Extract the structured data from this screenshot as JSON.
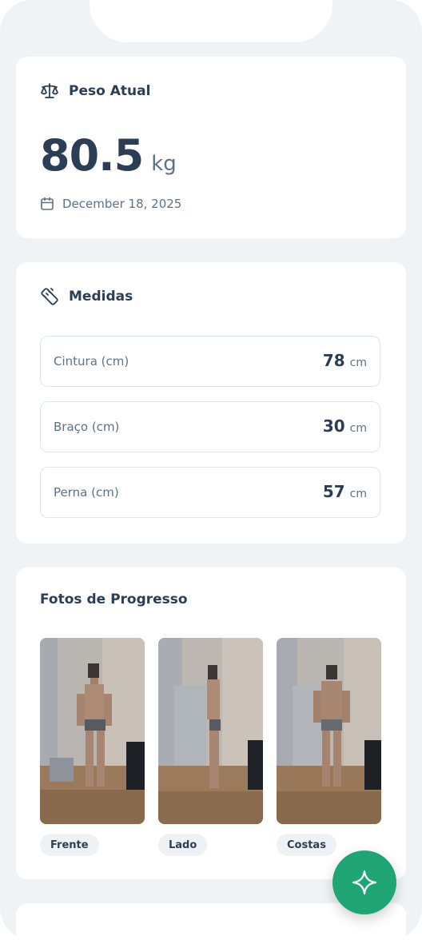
{
  "weight_card": {
    "title": "Peso Atual",
    "value": "80.5",
    "unit": "kg",
    "date": "December 18, 2025",
    "icons": {
      "title": "scale-icon",
      "date": "calendar-icon"
    }
  },
  "measures_card": {
    "title": "Medidas",
    "icon": "ruler-icon",
    "items": [
      {
        "label": "Cintura (cm)",
        "value": "78",
        "unit": "cm"
      },
      {
        "label": "Braço (cm)",
        "value": "30",
        "unit": "cm"
      },
      {
        "label": "Perna (cm)",
        "value": "57",
        "unit": "cm"
      }
    ]
  },
  "photos_card": {
    "title": "Fotos de Progresso",
    "photos": [
      {
        "label": "Frente"
      },
      {
        "label": "Lado"
      },
      {
        "label": "Costas"
      }
    ]
  },
  "fab": {
    "icon": "sparkle-icon"
  },
  "colors": {
    "background": "#eff3f5",
    "card": "#ffffff",
    "text_primary": "#2c3e55",
    "text_secondary": "#5d7189",
    "accent": "#1fa474"
  }
}
